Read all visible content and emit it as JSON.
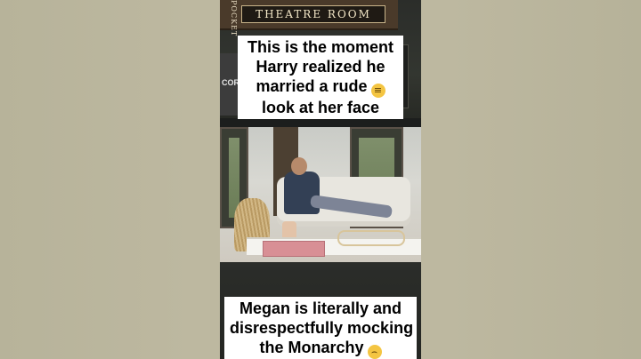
{
  "background": {
    "outer_color": "#bdb8a0",
    "frame_color": "#2a2c2b"
  },
  "room_sign": {
    "left_text": "POCKET",
    "theatre_text": "THEATRE ROOM",
    "popcorn_text": "CORN"
  },
  "caption_top": {
    "lines": [
      "This is the moment",
      "Harry realized he",
      "married a rude",
      "look at her face"
    ],
    "emoji": "grimacing-face"
  },
  "caption_bottom": {
    "lines": [
      "Megan is literally and",
      "disrespectfully mocking",
      "the Monarchy"
    ],
    "emoji": "disappointed-face"
  }
}
